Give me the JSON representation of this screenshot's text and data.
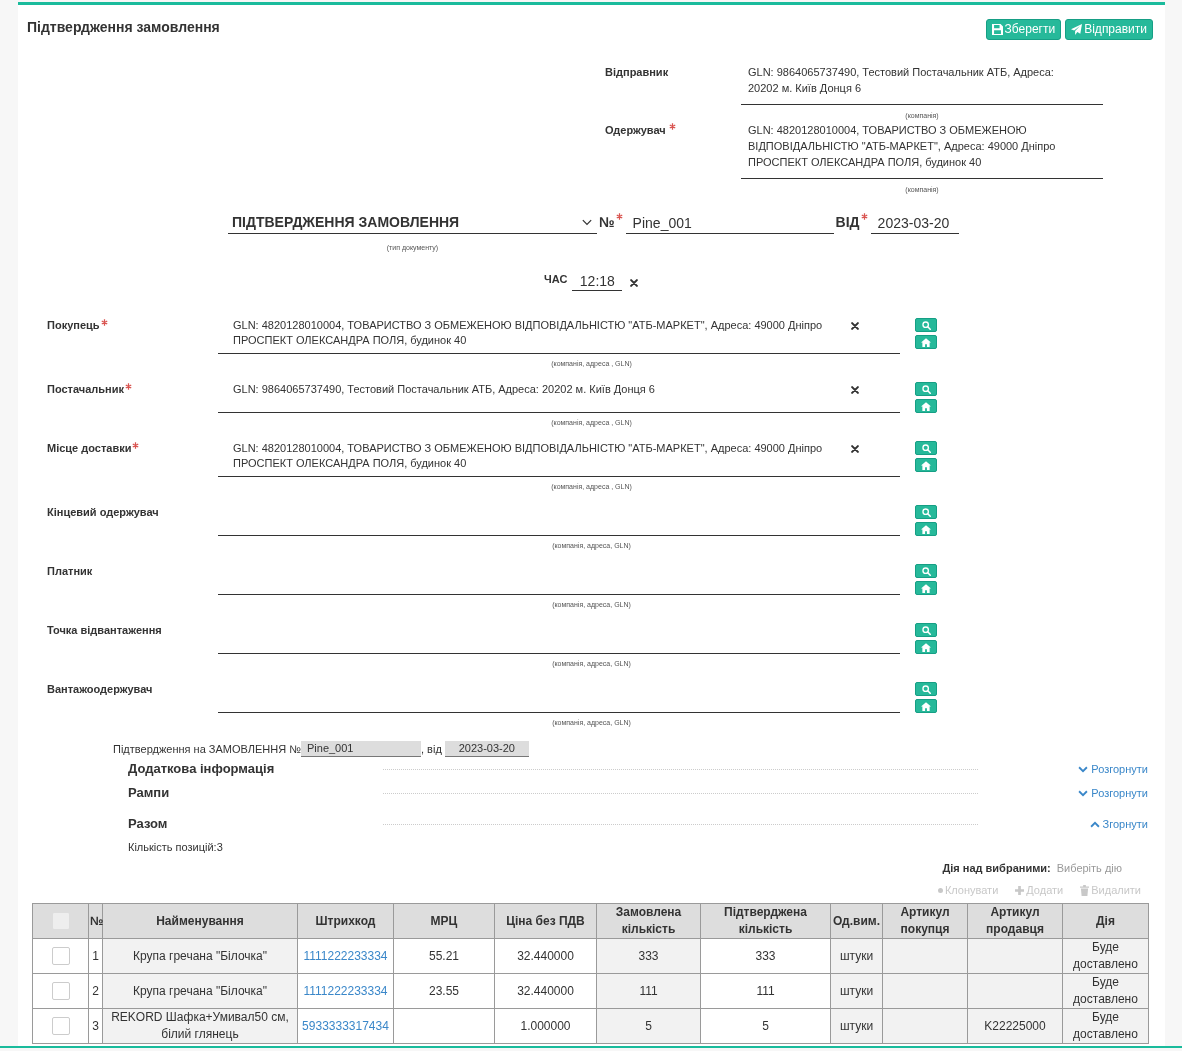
{
  "header": {
    "title": "Підтвердження замовлення",
    "buttons": [
      {
        "kind": "save",
        "label": "Зберегти"
      },
      {
        "kind": "send",
        "label": "Відправити"
      }
    ]
  },
  "top_parties": [
    {
      "label": "Відправник",
      "required": false,
      "value": "GLN: 9864065737490, Тестовий Постачальник АТБ, Адреса: 20202 м. Київ Донця 6",
      "caption": "(компанія)"
    },
    {
      "label": "Одержувач",
      "required": true,
      "value": "GLN: 4820128010004, ТОВАРИСТВО З ОБМЕЖЕНОЮ ВІДПОВІДАЛЬНІСТЮ \"АТБ-МАРКЕТ\", Адреса: 49000 Дніпро ПРОСПЕКТ ОЛЕКСАНДРА ПОЛЯ, будинок 40",
      "caption": "(компанія)"
    }
  ],
  "document": {
    "type": {
      "value": "ПІДТВЕРДЖЕННЯ ЗАМОВЛЕННЯ",
      "caption": "(тип документу)"
    },
    "number": {
      "label": "№",
      "required": true,
      "value": "Pine_001"
    },
    "date": {
      "label": "ВІД",
      "required": true,
      "value": "2023-03-20"
    },
    "time": {
      "label": "ЧАС",
      "value": "12:18"
    }
  },
  "parties": [
    {
      "label": "Покупець",
      "required": true,
      "value": "GLN: 4820128010004, ТОВАРИСТВО З ОБМЕЖЕНОЮ ВІДПОВІДАЛЬНІСТЮ \"АТБ-МАРКЕТ\", Адреса: 49000 Дніпро ПРОСПЕКТ ОЛЕКСАНДРА ПОЛЯ, будинок 40",
      "caption": "(компанія, адреса , GLN)"
    },
    {
      "label": "Постачальник",
      "required": true,
      "value": "GLN: 9864065737490, Тестовий Постачальник АТБ, Адреса: 20202 м. Київ Донця 6",
      "caption": "(компанія, адреса , GLN)"
    },
    {
      "label": "Місце доставки",
      "required": true,
      "value": "GLN: 4820128010004, ТОВАРИСТВО З ОБМЕЖЕНОЮ ВІДПОВІДАЛЬНІСТЮ \"АТБ-МАРКЕТ\", Адреса: 49000 Дніпро ПРОСПЕКТ ОЛЕКСАНДРА ПОЛЯ, будинок 40",
      "caption": "(компанія, адреса , GLN)"
    },
    {
      "label": "Кінцевий одержувач",
      "required": false,
      "caption": "(компанія, адреса, GLN)"
    },
    {
      "label": "Платник",
      "required": false,
      "caption": "(компанія, адреса, GLN)"
    },
    {
      "label": "Точка відвантаження",
      "required": false,
      "caption": "(компанія, адреса, GLN)"
    },
    {
      "label": "Вантажоодержувач",
      "required": false,
      "caption": "(компанія, адреса, GLN)"
    }
  ],
  "reference": {
    "label": "Підтвердження на ЗАМОВЛЕННЯ №",
    "number": "Pine_001",
    "date_label": ", від",
    "date": "2023-03-20"
  },
  "sections": [
    {
      "title": "Додаткова інформація",
      "expanded": false,
      "toggle": "Розгорнути"
    },
    {
      "title": "Рампи",
      "expanded": false,
      "toggle": "Розгорнути"
    },
    {
      "title": "Разом",
      "expanded": true,
      "toggle": "Згорнути",
      "summary": "Кількість позицій:3"
    }
  ],
  "bulk_actions": {
    "label": "Дія над вибраними:",
    "placeholder": "Виберіть дію",
    "items": [
      {
        "kind": "clone",
        "label": "Клонувати",
        "disabled": true
      },
      {
        "kind": "add",
        "label": "Додати",
        "disabled": true
      },
      {
        "kind": "delete",
        "label": "Видалити",
        "disabled": true
      }
    ]
  },
  "table": {
    "select_all": {
      "checked": false,
      "disabled": true
    },
    "columns": [
      {
        "label": "№",
        "readonly": false
      },
      {
        "label": "Найменування",
        "readonly": true
      },
      {
        "label": "Штрихкод",
        "readonly": false
      },
      {
        "label": "МРЦ",
        "readonly": false
      },
      {
        "label": "Ціна без ПДВ",
        "readonly": false
      },
      {
        "label": "Замовлена кількість",
        "readonly": true
      },
      {
        "label": "Підтверджена кількість",
        "readonly": false
      },
      {
        "label": "Од.вим.",
        "readonly": true
      },
      {
        "label": "Артикул покупця",
        "readonly": true
      },
      {
        "label": "Артикул продавця",
        "readonly": true
      },
      {
        "label": "Дія",
        "readonly": true
      }
    ],
    "rows": [
      {
        "selected": false,
        "number": "1",
        "name": "Крупа гречана \"Білочка\"",
        "barcode": "1111222233334",
        "mrc": "55.21",
        "price_excl_vat": "32.440000",
        "ordered_quantity": "333",
        "confirmed_quantity": "333",
        "unit": "штуки",
        "action": "Буде доставлено"
      },
      {
        "selected": false,
        "number": "2",
        "name": "Крупа гречана \"Білочка\"",
        "barcode": "1111222233334",
        "mrc": "23.55",
        "price_excl_vat": "32.440000",
        "ordered_quantity": "111",
        "confirmed_quantity": "111",
        "unit": "штуки",
        "action": "Буде доставлено"
      },
      {
        "selected": false,
        "number": "3",
        "name": "REKORD Шафка+Умивал50 см, білий глянець",
        "barcode": "5933333317434",
        "price_excl_vat": "1.000000",
        "ordered_quantity": "5",
        "confirmed_quantity": "5",
        "unit": "штуки",
        "seller_article": "K22225000",
        "action": "Буде доставлено"
      }
    ]
  }
}
